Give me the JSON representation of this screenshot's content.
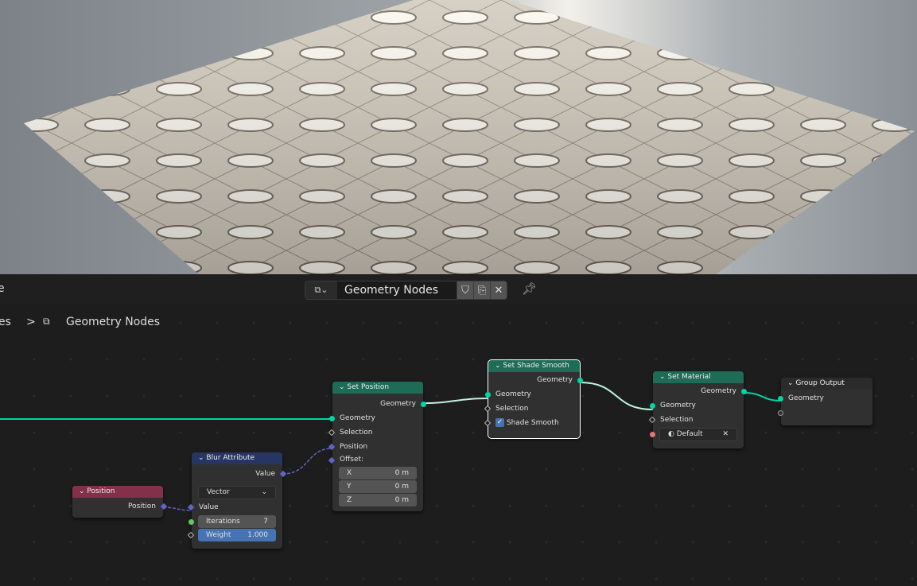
{
  "header": {
    "datablock_name": "Geometry Nodes",
    "icons": [
      "node-tree-icon",
      "shield-fake-user-icon",
      "duplicate-icon",
      "close-icon",
      "pin-icon"
    ]
  },
  "breadcrumb": {
    "partial": "es",
    "separator": ">",
    "current": "Geometry Nodes"
  },
  "left_partial": "e",
  "nodes": {
    "set_position": {
      "title": "Set Position",
      "out": "Geometry",
      "inputs": [
        "Geometry",
        "Selection",
        "Position",
        "Offset:"
      ],
      "offset": [
        {
          "axis": "X",
          "value": "0 m"
        },
        {
          "axis": "Y",
          "value": "0 m"
        },
        {
          "axis": "Z",
          "value": "0 m"
        }
      ]
    },
    "shade_smooth": {
      "title": "Set Shade Smooth",
      "out": "Geometry",
      "inputs": [
        "Geometry",
        "Selection"
      ],
      "checkbox_label": "Shade Smooth",
      "checked": true
    },
    "set_material": {
      "title": "Set Material",
      "out": "Geometry",
      "inputs": [
        "Geometry",
        "Selection"
      ],
      "material": "Default"
    },
    "group_output": {
      "title": "Group Output",
      "inputs": [
        "Geometry"
      ]
    },
    "blur": {
      "title": "Blur Attribute",
      "out": "Value",
      "type": "Vector",
      "input": "Value",
      "iterations_label": "Iterations",
      "iterations": "7",
      "weight_label": "Weight",
      "weight": "1.000"
    },
    "position": {
      "title": "Position",
      "out": "Position"
    }
  },
  "colors": {
    "geometry_node": "#1e6b56",
    "attribute_node": "#283462",
    "input_node": "#83314a",
    "output_node": "#2b2b2b",
    "geometry_socket": "#00d6a3",
    "vector_socket": "#6363c7"
  }
}
